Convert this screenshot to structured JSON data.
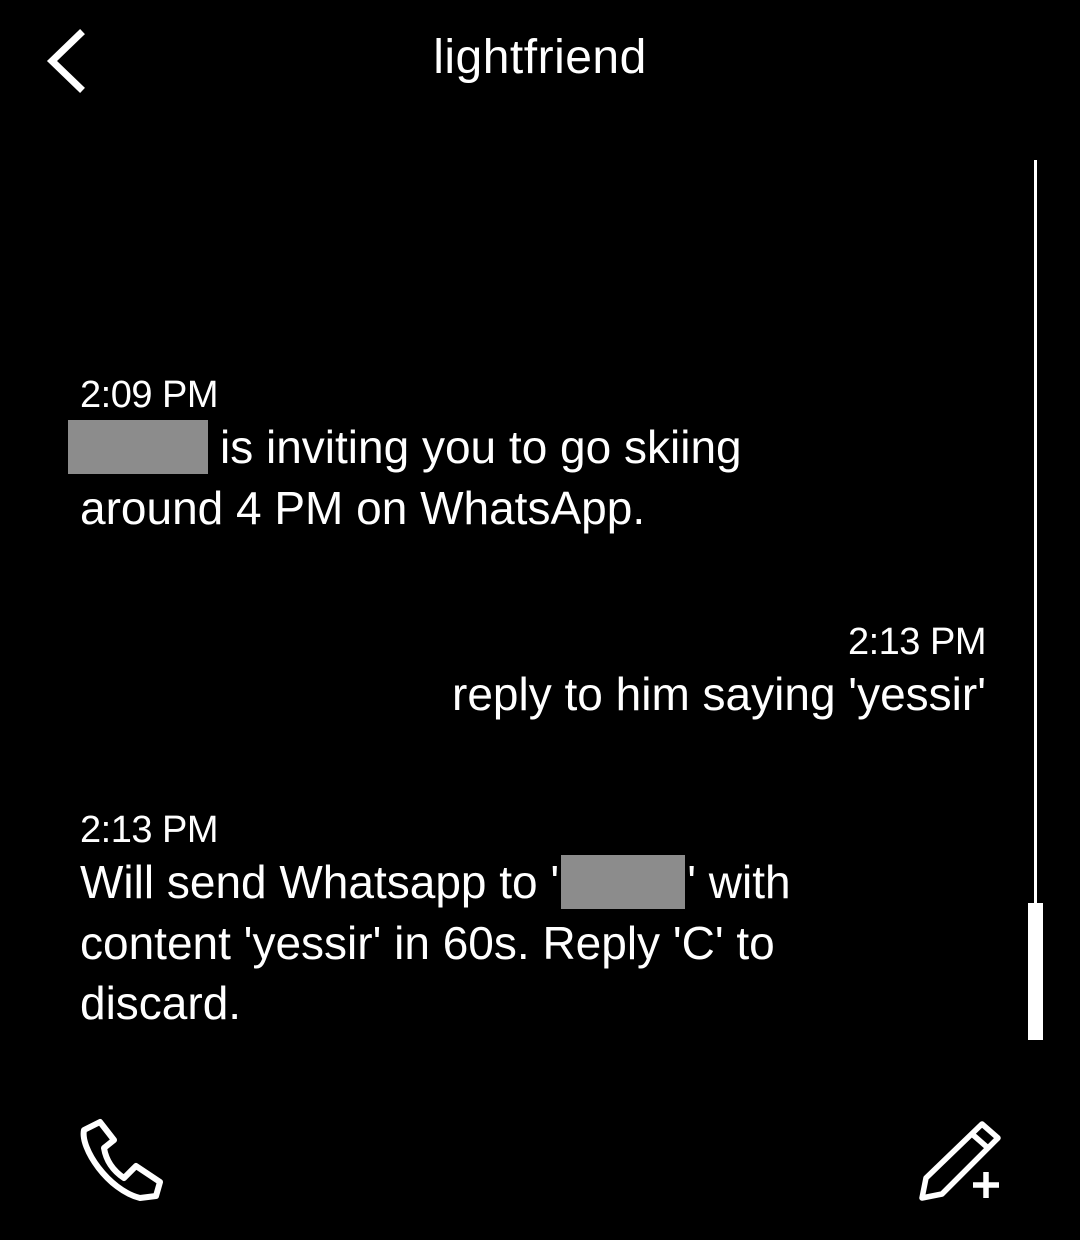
{
  "header": {
    "title": "lightfriend",
    "back_icon": "chevron-left-icon"
  },
  "messages": [
    {
      "sender": "contact",
      "time": "2:09 PM",
      "redacted_name": true,
      "text_line1": "is inviting you to go skiing",
      "text_line2": "around 4 PM on WhatsApp."
    },
    {
      "sender": "user",
      "time": "2:13 PM",
      "text": "reply to him saying 'yessir'"
    },
    {
      "sender": "contact",
      "time": "2:13 PM",
      "text_prefix": "Will send Whatsapp to '",
      "redacted_name": true,
      "text_suffix": "' with",
      "text_line2": "content 'yessir' in 60s. Reply 'C' to",
      "text_line3": "discard."
    }
  ],
  "toolbar": {
    "phone_icon": "phone-icon",
    "compose_icon": "pencil-plus-icon"
  },
  "colors": {
    "background": "#000000",
    "text": "#ffffff",
    "redaction": "#8c8c8c"
  }
}
